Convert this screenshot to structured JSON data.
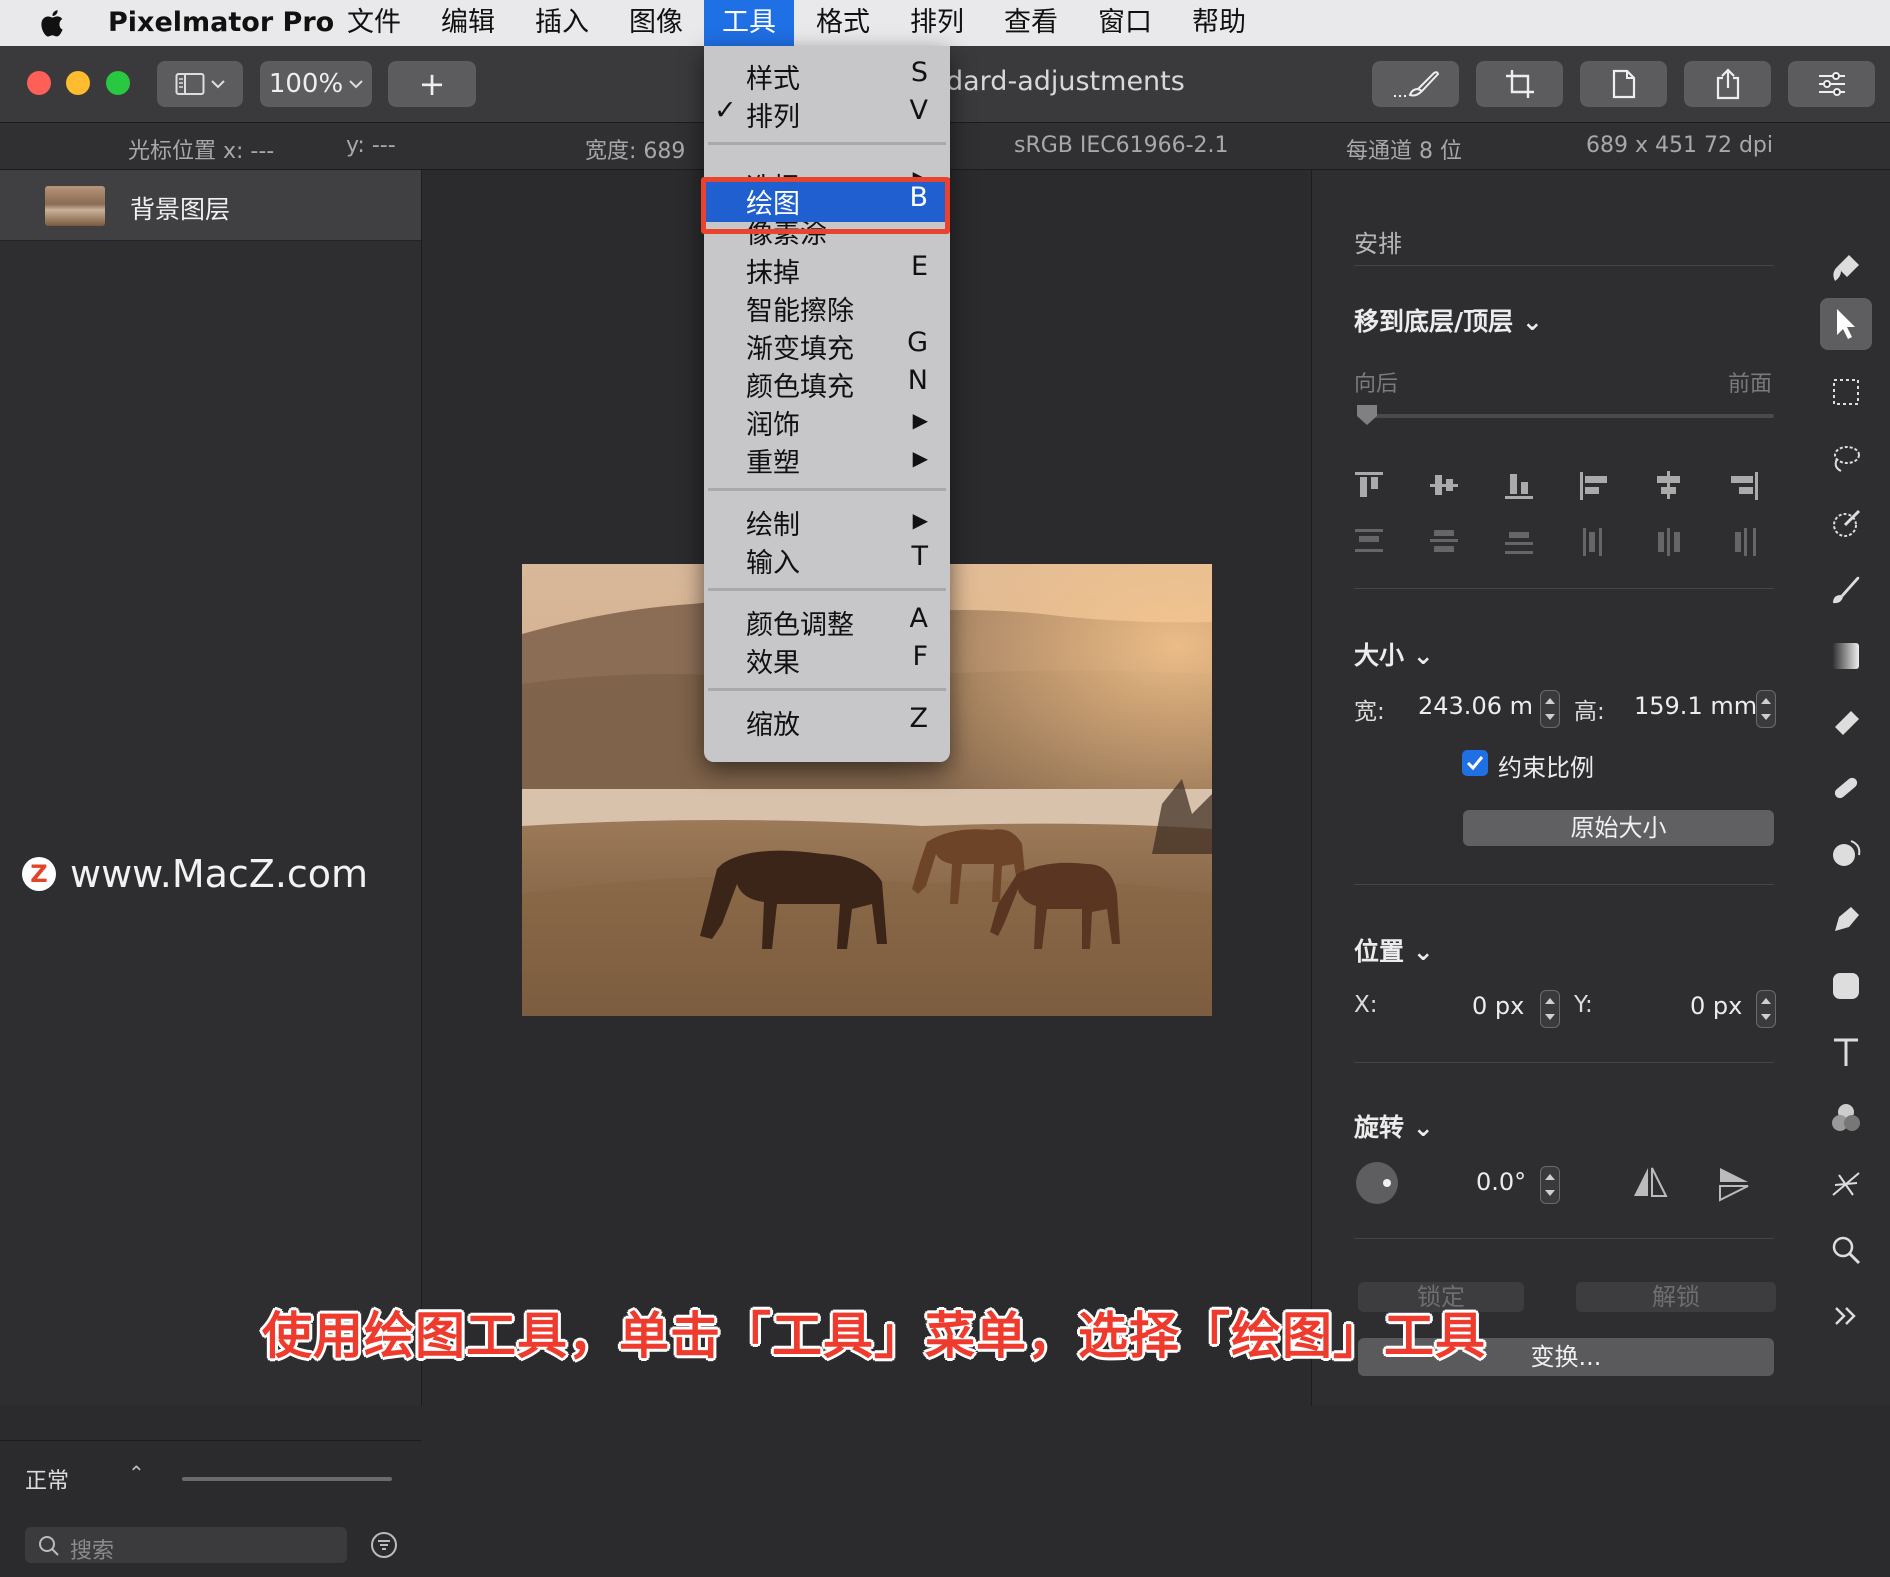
{
  "menubar": {
    "app_name": "Pixelmator Pro",
    "items": [
      "文件",
      "编辑",
      "插入",
      "图像",
      "工具",
      "格式",
      "排列",
      "查看",
      "窗口",
      "帮助"
    ],
    "active_item": "工具"
  },
  "toolbar": {
    "zoom": "100%",
    "add_label": "+",
    "document_title": "dard-adjustments"
  },
  "infobar": {
    "cursor_x": "光标位置 x:  ---",
    "cursor_y": "y:  ---",
    "width": "宽度:  689",
    "colorspace": "sRGB IEC61966-2.1",
    "bit_depth": "每通道 8 位",
    "size_dpi": "689 x 451 72 dpi"
  },
  "layers": {
    "items": [
      {
        "name": "背景图层"
      }
    ],
    "blend_mode": "正常",
    "search_placeholder": "搜索"
  },
  "watermark": {
    "logo": "Z",
    "text": "www.MacZ.com"
  },
  "tools_menu": {
    "items": [
      {
        "label": "样式",
        "key": "S"
      },
      {
        "label": "排列",
        "key": "V",
        "checked": true
      },
      {
        "label": "选择",
        "key": "▶"
      },
      {
        "label": "绘图",
        "key": "B",
        "highlighted": true
      },
      {
        "label": "像素涂",
        "key": ""
      },
      {
        "label": "抹掉",
        "key": "E"
      },
      {
        "label": "智能擦除",
        "key": ""
      },
      {
        "label": "渐变填充",
        "key": "G"
      },
      {
        "label": "颜色填充",
        "key": "N"
      },
      {
        "label": "润饰",
        "key": "▶"
      },
      {
        "label": "重塑",
        "key": "▶"
      },
      {
        "label": "绘制",
        "key": "▶"
      },
      {
        "label": "输入",
        "key": "T"
      },
      {
        "label": "颜色调整",
        "key": "A"
      },
      {
        "label": "效果",
        "key": "F"
      },
      {
        "label": "缩放",
        "key": "Z"
      }
    ],
    "check_mark": "✓"
  },
  "inspector": {
    "arrange": {
      "title": "安排",
      "move_label": "移到底层/顶层",
      "back_label": "向后",
      "front_label": "前面"
    },
    "size": {
      "title": "大小",
      "width_label": "宽:",
      "width_value": "243.06 m",
      "height_label": "高:",
      "height_value": "159.1 mm",
      "constrain_label": "约束比例",
      "constrain_checked": true,
      "original_size_button": "原始大小"
    },
    "position": {
      "title": "位置",
      "x_label": "X:",
      "x_value": "0 px",
      "y_label": "Y:",
      "y_value": "0 px"
    },
    "rotate": {
      "title": "旋转",
      "value": "0.0°"
    },
    "lock_button": "锁定",
    "unlock_button": "解锁",
    "transform_button": "变换..."
  },
  "caption": "使用绘图工具，单击「工具」菜单，选择「绘图」工具",
  "colors": {
    "menu_highlight": "#1f5fd0",
    "annotation_red": "#e8432f",
    "selection_blue": "#1f6fe5"
  }
}
